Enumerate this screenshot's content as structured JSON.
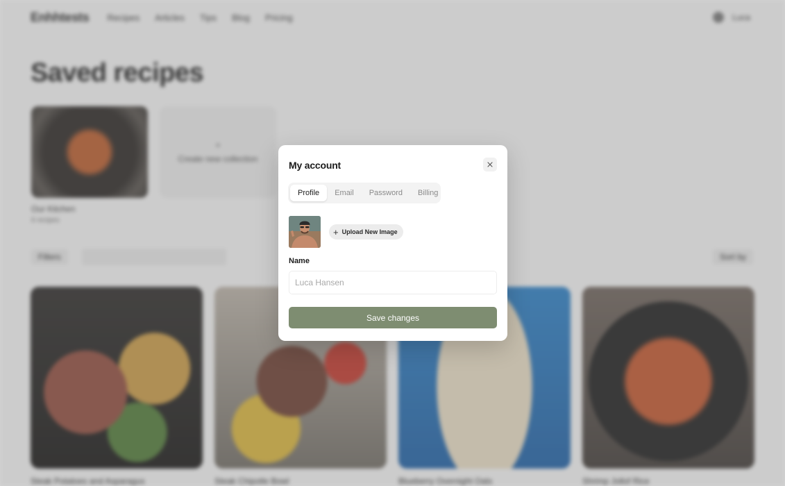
{
  "background": {
    "logo": "Enhhtests",
    "nav": [
      "Recipes",
      "Articles",
      "Tips",
      "Blog",
      "Pricing"
    ],
    "user": "Luca",
    "page_title": "Saved recipes",
    "collection": {
      "name": "Our Kitchen",
      "meta": "6 recipes"
    },
    "new_collection_label": "Create new collection",
    "filter_label": "Filters",
    "sort_label": "Sort by",
    "recipes": [
      "Steak Potatoes and Asparagus",
      "Steak Chipotle Bowl",
      "Blueberry Overnight Oats",
      "Shrimp Jollof Rice"
    ]
  },
  "modal": {
    "title": "My account",
    "tabs": [
      {
        "label": "Profile",
        "active": true
      },
      {
        "label": "Email",
        "active": false
      },
      {
        "label": "Password",
        "active": false
      },
      {
        "label": "Billing",
        "active": false
      }
    ],
    "upload_label": "Upload New Image",
    "name_label": "Name",
    "name_placeholder": "Luca Hansen",
    "save_label": "Save changes",
    "accent_color": "#7e8d71"
  }
}
